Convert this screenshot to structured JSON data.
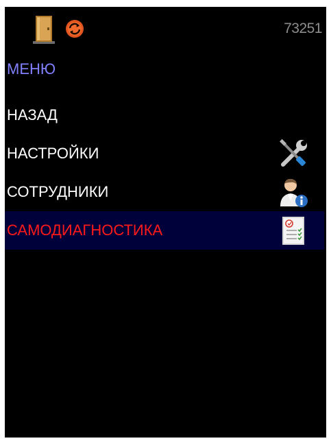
{
  "header": {
    "door_icon": "door-icon",
    "sync_icon": "sync-icon",
    "device_id": "73251"
  },
  "menu": {
    "title": "МЕНЮ",
    "items": [
      {
        "label": "НАЗАД",
        "icon": null,
        "selected": false
      },
      {
        "label": "НАСТРОЙКИ",
        "icon": "tools-icon",
        "selected": false
      },
      {
        "label": "СОТРУДНИКИ",
        "icon": "user-info-icon",
        "selected": false
      },
      {
        "label": "САМОДИАГНОСТИКА",
        "icon": "checklist-icon",
        "selected": true
      }
    ]
  },
  "colors": {
    "background": "#000000",
    "title": "#8080ff",
    "item_text": "#ffffff",
    "selected_text": "#ff1a1a",
    "selected_background": "#00003a",
    "device_id": "#8c8c8c",
    "sync_icon": "#e2541e"
  }
}
